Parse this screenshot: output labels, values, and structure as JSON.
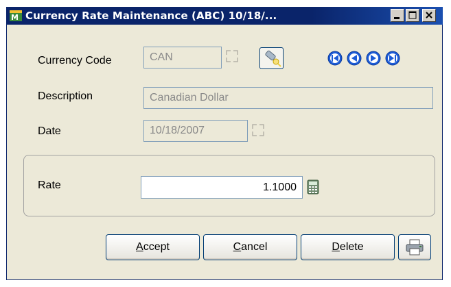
{
  "window": {
    "title": "Currency Rate Maintenance (ABC) 10/18/...",
    "icon": "sage-mas-app-icon",
    "controls": [
      "minimize-icon",
      "maximize-icon",
      "close-icon"
    ]
  },
  "form": {
    "currency_code": {
      "label": "Currency Code",
      "value": "CAN"
    },
    "description": {
      "label": "Description",
      "value": "Canadian Dollar"
    },
    "date": {
      "label": "Date",
      "value": "10/18/2007"
    },
    "rate": {
      "label": "Rate",
      "value": "1.1000"
    }
  },
  "navigation": [
    "first-record-icon",
    "previous-record-icon",
    "next-record-icon",
    "last-record-icon"
  ],
  "buttons": {
    "accept": {
      "mnemonic": "A",
      "rest": "ccept"
    },
    "cancel": {
      "mnemonic": "C",
      "rest": "ancel"
    },
    "delete": {
      "mnemonic": "D",
      "rest": "elete"
    }
  },
  "colors": {
    "titlebar": "#0a246a",
    "window_bg": "#ece9d8",
    "field_border": "#7f9db9",
    "nav_blue": "#1c5bd6"
  }
}
